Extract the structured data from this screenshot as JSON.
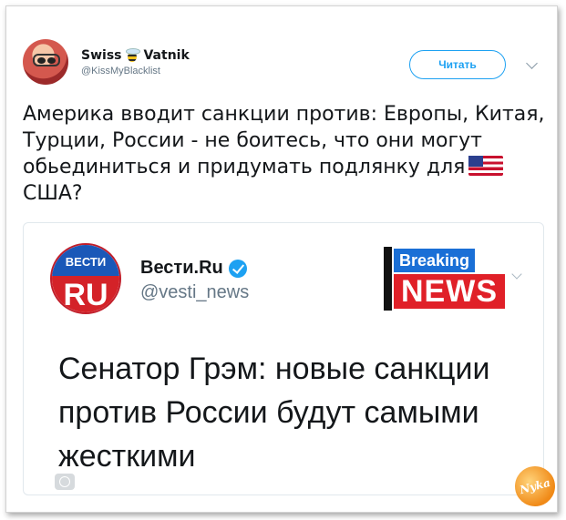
{
  "tweet": {
    "author": {
      "name_first": "Swiss",
      "name_second": "Vatnik",
      "handle": "@KissMyBlacklist"
    },
    "follow_label": "Читать",
    "text_before_flag": "Америка вводит санкции против: Европы, Китая, Турции, России - не боитесь, что они могут обьединиться и придумать подлянку для",
    "text_after_flag": "США?",
    "icons": [
      "avatar",
      "bee-icon",
      "caret-icon",
      "us-flag-icon"
    ]
  },
  "quote": {
    "logo": {
      "top": "ВЕСТИ",
      "bottom": "RU"
    },
    "name": "Вести.Ru",
    "handle": "@vesti_news",
    "badge": {
      "line1": "Breaking",
      "line2": "NEWS"
    },
    "text": "Сенатор Грэм: новые санкции против России будут самыми жесткими",
    "icons": [
      "verified-icon",
      "caret-icon",
      "emoji-icon"
    ]
  },
  "watermark": "Nyka",
  "colors": {
    "accent": "#1da1f2",
    "vesti_blue": "#1a58b8",
    "vesti_red": "#d42228",
    "news_red": "#e02028"
  }
}
